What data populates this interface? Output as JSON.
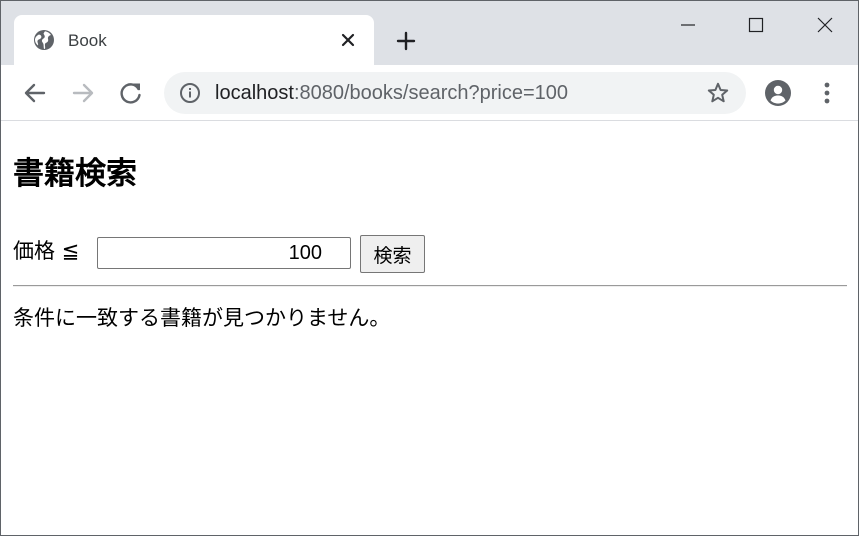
{
  "browser": {
    "tab": {
      "title": "Book",
      "favicon": "globe-icon"
    },
    "address_bar": {
      "host": "localhost",
      "rest": ":8080/books/search?price=100"
    },
    "icons": {
      "back": "arrow-left-icon",
      "forward": "arrow-right-icon",
      "reload": "reload-icon",
      "site_info": "info-icon",
      "bookmark": "star-icon",
      "profile": "account-circle-icon",
      "menu": "three-dots-vertical-icon",
      "new_tab": "plus-icon",
      "minimize": "minimize-icon",
      "maximize": "maximize-icon",
      "close": "close-icon"
    }
  },
  "page": {
    "title": "書籍検索",
    "form": {
      "price_label": "価格 ≦",
      "price_value": "100",
      "search_button_label": "検索"
    },
    "result_message": "条件に一致する書籍が見つかりません。"
  },
  "colors": {
    "tabstrip_bg": "#dee1e6",
    "omnibox_bg": "#f1f3f4",
    "icon_gray": "#5f6368",
    "forward_disabled": "#b8bbbf"
  }
}
